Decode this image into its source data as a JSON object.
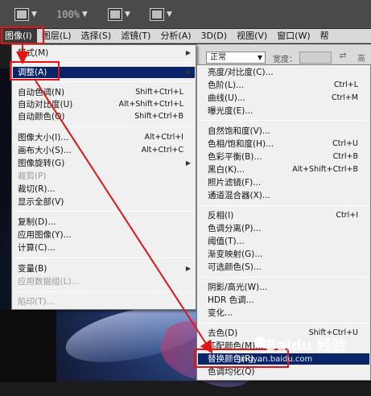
{
  "toolbar": {
    "zoom": "100%",
    "icons": [
      "film-icon",
      "zoom-dropdown",
      "view-layout-icon",
      "arrange-icon"
    ]
  },
  "menubar": [
    {
      "label": "图像(I)",
      "active": true
    },
    {
      "label": "图层(L)"
    },
    {
      "label": "选择(S)"
    },
    {
      "label": "滤镜(T)"
    },
    {
      "label": "分析(A)"
    },
    {
      "label": "3D(D)"
    },
    {
      "label": "视图(V)"
    },
    {
      "label": "窗口(W)"
    },
    {
      "label": "帮"
    }
  ],
  "options_bar": {
    "mode_value": "正常",
    "width_label": "宽度："
  },
  "image_menu": [
    {
      "label": "模式(M)",
      "submenu": true
    },
    {
      "label": "调整(A)",
      "submenu": true,
      "highlight": true
    },
    {
      "label": "自动色调(N)",
      "shortcut": "Shift+Ctrl+L"
    },
    {
      "label": "自动对比度(U)",
      "shortcut": "Alt+Shift+Ctrl+L"
    },
    {
      "label": "自动颜色(O)",
      "shortcut": "Shift+Ctrl+B"
    },
    {
      "label": "图像大小(I)...",
      "shortcut": "Alt+Ctrl+I"
    },
    {
      "label": "画布大小(S)...",
      "shortcut": "Alt+Ctrl+C"
    },
    {
      "label": "图像旋转(G)",
      "submenu": true
    },
    {
      "label": "裁剪(P)",
      "disabled": true
    },
    {
      "label": "裁切(R)..."
    },
    {
      "label": "显示全部(V)"
    },
    {
      "label": "复制(D)..."
    },
    {
      "label": "应用图像(Y)..."
    },
    {
      "label": "计算(C)..."
    },
    {
      "label": "变量(B)",
      "submenu": true
    },
    {
      "label": "应用数据组(L)...",
      "disabled": true
    },
    {
      "label": "陷印(T)...",
      "disabled": true
    }
  ],
  "adjust_menu": [
    {
      "label": "亮度/对比度(C)..."
    },
    {
      "label": "色阶(L)...",
      "shortcut": "Ctrl+L"
    },
    {
      "label": "曲线(U)...",
      "shortcut": "Ctrl+M"
    },
    {
      "label": "曝光度(E)..."
    },
    {
      "label": "自然饱和度(V)..."
    },
    {
      "label": "色相/饱和度(H)...",
      "shortcut": "Ctrl+U"
    },
    {
      "label": "色彩平衡(B)...",
      "shortcut": "Ctrl+B"
    },
    {
      "label": "黑白(K)...",
      "shortcut": "Alt+Shift+Ctrl+B"
    },
    {
      "label": "照片滤镜(F)..."
    },
    {
      "label": "通道混合器(X)..."
    },
    {
      "label": "反相(I)",
      "shortcut": "Ctrl+I"
    },
    {
      "label": "色调分离(P)..."
    },
    {
      "label": "阈值(T)..."
    },
    {
      "label": "渐变映射(G)..."
    },
    {
      "label": "可选颜色(S)..."
    },
    {
      "label": "阴影/高光(W)..."
    },
    {
      "label": "HDR 色调..."
    },
    {
      "label": "变化..."
    },
    {
      "label": "去色(D)",
      "shortcut": "Shift+Ctrl+U"
    },
    {
      "label": "匹配颜色(M)..."
    },
    {
      "label": "替换颜色(R)...",
      "highlight": true
    },
    {
      "label": "色调均化(Q)"
    }
  ],
  "watermark": {
    "brand": "Baidu 经验",
    "url": "jingyan.baidu.com"
  }
}
